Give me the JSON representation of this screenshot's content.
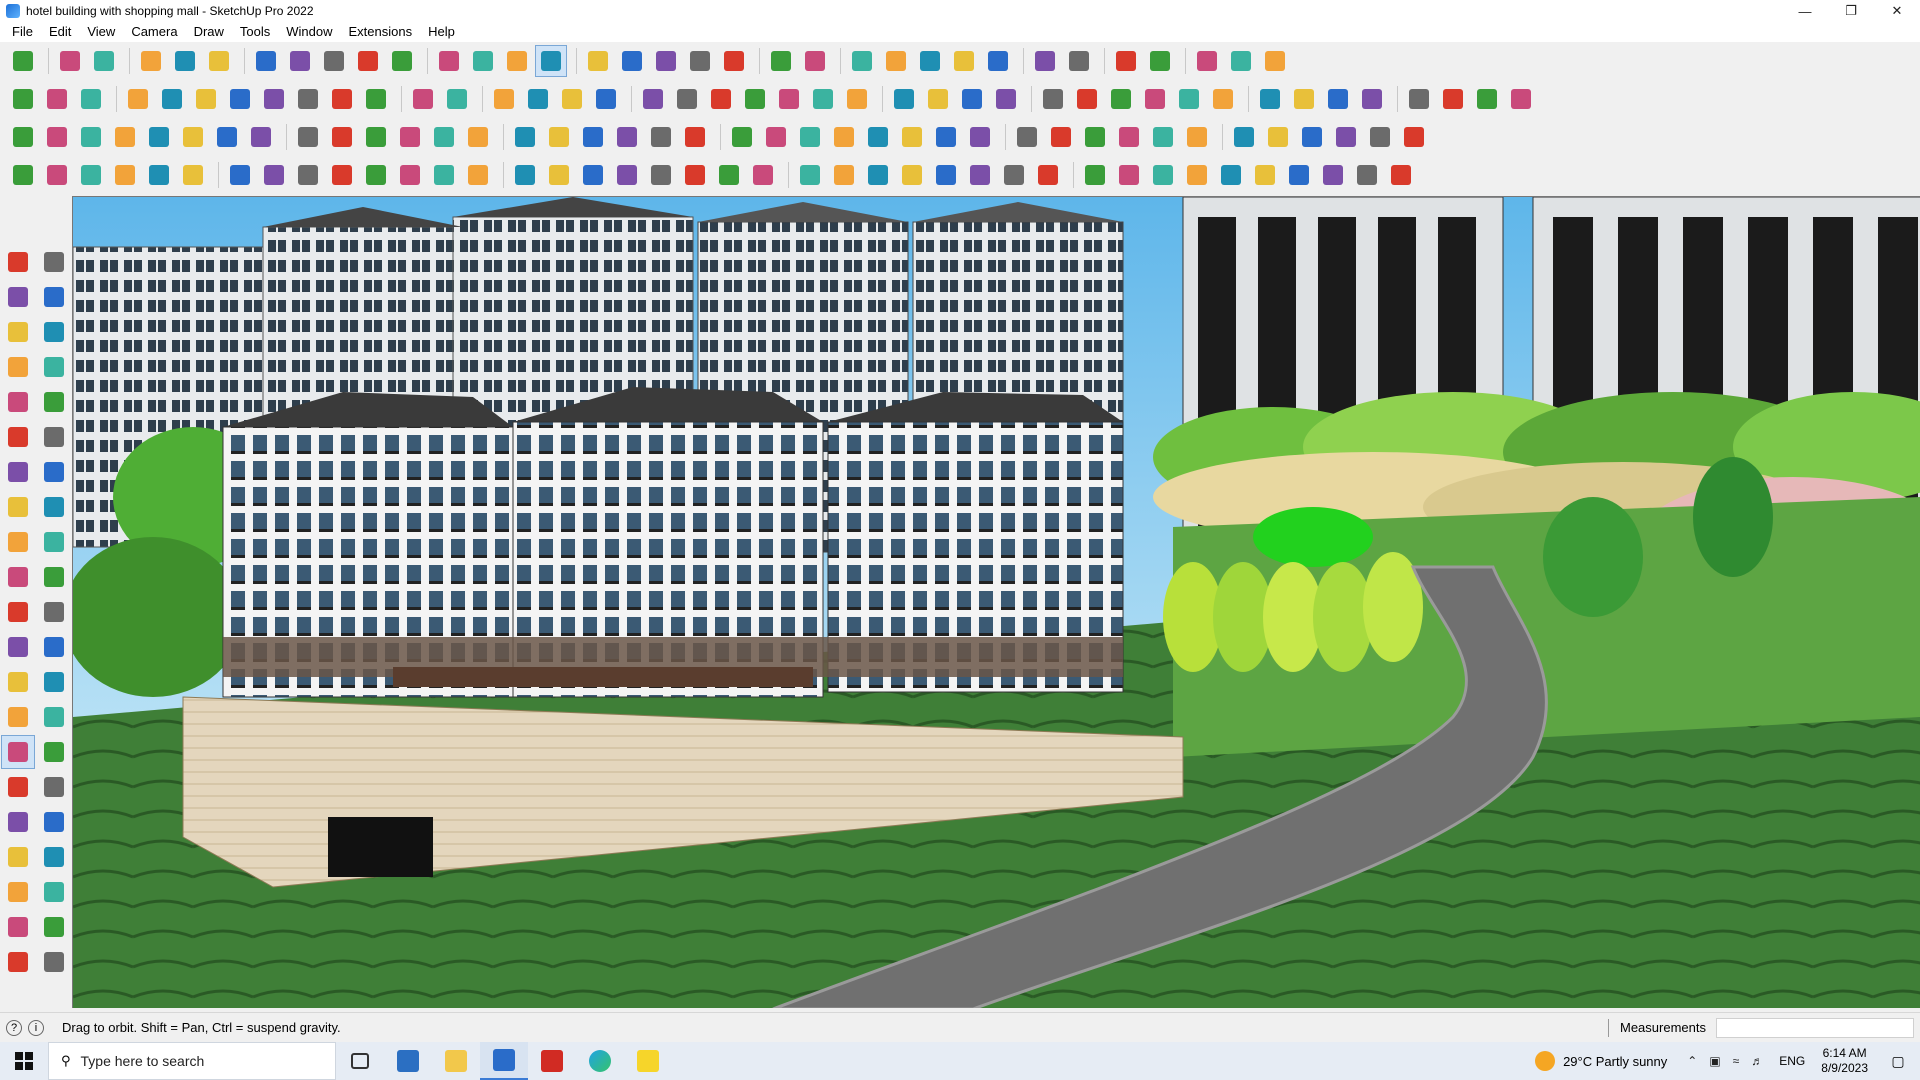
{
  "window": {
    "title": "hotel building with shopping mall - SketchUp Pro 2022",
    "icon": "sketchup-icon",
    "controls": [
      "minimize",
      "restore",
      "close"
    ]
  },
  "menu": [
    "File",
    "Edit",
    "View",
    "Camera",
    "Draw",
    "Tools",
    "Window",
    "Extensions",
    "Help"
  ],
  "toolbars": {
    "row1_icons": [
      "zoom",
      "select",
      "eraser",
      "pencil",
      "line",
      "paint",
      "pushpull",
      "followme",
      "move",
      "rotate",
      "scale",
      "tape",
      "text",
      "paint-bucket",
      "orbit",
      "pan",
      "zoom",
      "zoom-extents",
      "xray",
      "section",
      "styles",
      "layers",
      "outliner",
      "components",
      "scenes",
      "shadows",
      "fog",
      "match-photo",
      "undo",
      "redo",
      "delete"
    ],
    "active_tool": "orbit"
  },
  "viewport": {
    "scene": "hotel building with shopping mall",
    "colors": {
      "sky": "#7cc4ec",
      "grass": "#3e7d35",
      "road": "#6b6b6b",
      "building": "#ffffff",
      "tower": "#d8dde0"
    }
  },
  "status": {
    "hint": "Drag to orbit. Shift = Pan, Ctrl = suspend gravity.",
    "measurements_label": "Measurements",
    "measurements_value": ""
  },
  "taskbar": {
    "search_placeholder": "Type here to search",
    "weather": "29°C  Partly sunny",
    "language": "ENG",
    "time": "6:14 AM",
    "date": "8/9/2023"
  }
}
